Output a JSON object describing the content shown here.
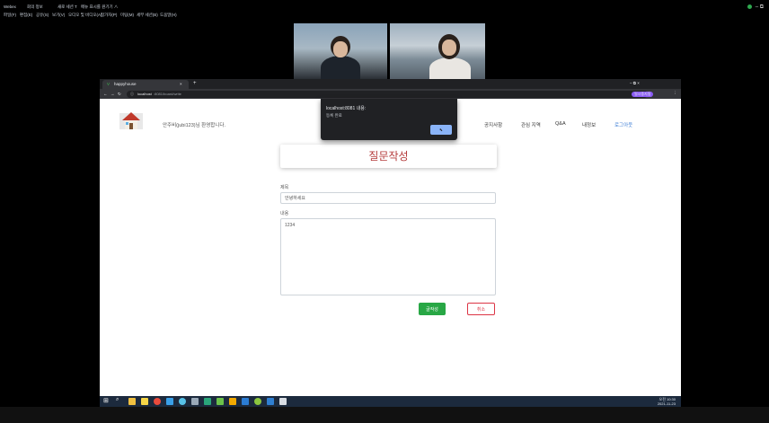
{
  "app_bar": {
    "app_name": "Webex",
    "meeting_info": "회의 정보",
    "items": [
      "새로 세션 T",
      "메뉴 표시를 원기기 ∧"
    ],
    "menu": [
      "파일(F)",
      "편집(E)",
      "공유(S)",
      "보기(V)",
      "오디오 및 비디오(A)",
      "참가자(P)",
      "미팅(M)",
      "세부 세션(B)",
      "도움말(H)"
    ],
    "window_controls": "–  ⧉"
  },
  "browser": {
    "tab_title": "happyhouse",
    "tab_close": "×",
    "new_tab": "+",
    "url_host": "localhost",
    "url_path": ":8081/board/write",
    "profile_label": "일시중지됨",
    "window_controls": "–  ⧉  ×"
  },
  "site": {
    "welcome": "안주비(jubi123)님 환영합니다.",
    "nav": [
      "공지사항",
      "관심 지역",
      "Q&A",
      "내정보",
      "로그아웃"
    ]
  },
  "alert": {
    "title": "localhost:8081 내용:",
    "message": "등록 완료"
  },
  "form": {
    "heading": "질문작성",
    "title_label": "제목",
    "title_value": "안녕하세요",
    "content_label": "내용",
    "content_value": "1234",
    "submit_label": "글작성",
    "cancel_label": "취소"
  },
  "taskbar": {
    "time": "오전 10:30",
    "date": "2021-11-23"
  },
  "colors": {
    "accent_green": "#28a745",
    "cancel_red": "#dc3545",
    "heading_red": "#b43a3a",
    "alert_button": "#8ab4f8"
  }
}
